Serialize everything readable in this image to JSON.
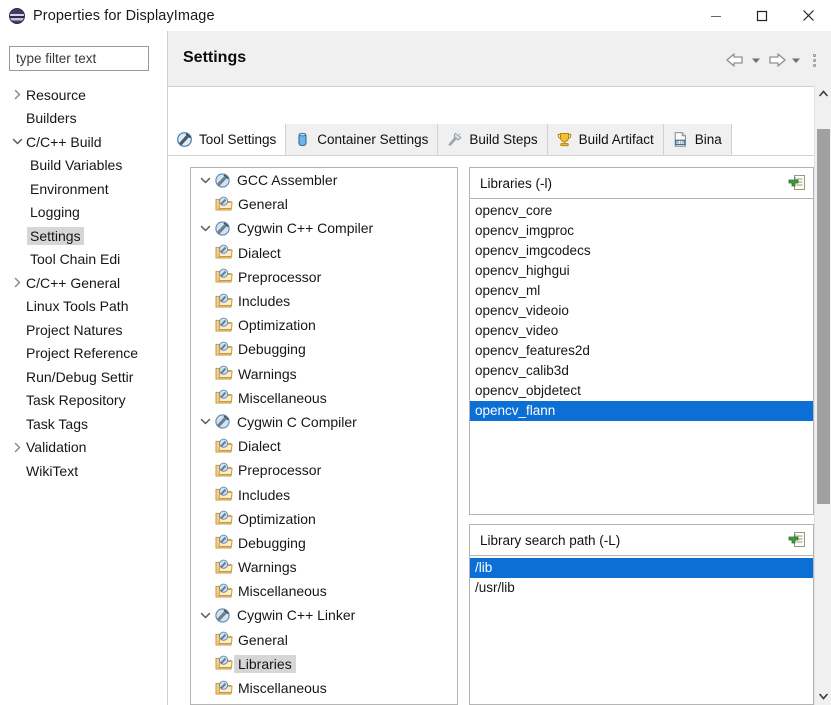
{
  "window": {
    "title": "Properties for DisplayImage",
    "icon": "eclipse-icon",
    "minimize_label": "—",
    "maximize_label": "□",
    "close_label": "✕"
  },
  "sidebar": {
    "filter": {
      "placeholder": "type filter text",
      "value": ""
    },
    "items": [
      {
        "label": "Resource",
        "indent": 0,
        "arrow": "collapsed",
        "selected": false
      },
      {
        "label": "Builders",
        "indent": 0,
        "arrow": "none",
        "selected": false
      },
      {
        "label": "C/C++ Build",
        "indent": 0,
        "arrow": "expanded",
        "selected": false
      },
      {
        "label": "Build Variables",
        "indent": 1,
        "arrow": "none",
        "selected": false
      },
      {
        "label": "Environment",
        "indent": 1,
        "arrow": "none",
        "selected": false
      },
      {
        "label": "Logging",
        "indent": 1,
        "arrow": "none",
        "selected": false
      },
      {
        "label": "Settings",
        "indent": 1,
        "arrow": "none",
        "selected": true
      },
      {
        "label": "Tool Chain Edi",
        "indent": 1,
        "arrow": "none",
        "selected": false
      },
      {
        "label": "C/C++ General",
        "indent": 0,
        "arrow": "collapsed",
        "selected": false
      },
      {
        "label": "Linux Tools Path",
        "indent": 0,
        "arrow": "none",
        "selected": false
      },
      {
        "label": "Project Natures",
        "indent": 0,
        "arrow": "none",
        "selected": false
      },
      {
        "label": "Project Reference",
        "indent": 0,
        "arrow": "none",
        "selected": false
      },
      {
        "label": "Run/Debug Settir",
        "indent": 0,
        "arrow": "none",
        "selected": false
      },
      {
        "label": "Task Repository",
        "indent": 0,
        "arrow": "none",
        "selected": false
      },
      {
        "label": "Task Tags",
        "indent": 0,
        "arrow": "none",
        "selected": false
      },
      {
        "label": "Validation",
        "indent": 0,
        "arrow": "collapsed",
        "selected": false
      },
      {
        "label": "WikiText",
        "indent": 0,
        "arrow": "none",
        "selected": false
      }
    ]
  },
  "header": {
    "title": "Settings",
    "back_icon": "back-arrow-icon",
    "back_dropdown_icon": "chevron-down-icon",
    "forward_icon": "forward-arrow-icon",
    "forward_dropdown_icon": "chevron-down-icon",
    "menu_icon": "kebab-menu-icon"
  },
  "tabs": [
    {
      "label": "Tool Settings",
      "icon": "tool-settings-icon",
      "active": true
    },
    {
      "label": "Container Settings",
      "icon": "container-icon",
      "active": false
    },
    {
      "label": "Build Steps",
      "icon": "build-steps-icon",
      "active": false
    },
    {
      "label": "Build Artifact",
      "icon": "trophy-icon",
      "active": false
    },
    {
      "label": "Bina",
      "icon": "binary-file-icon",
      "active": false
    }
  ],
  "tool_tree": [
    {
      "label": "GCC Assembler",
      "indent": 0,
      "arrow": "expanded",
      "icon": "tool-icon",
      "selected": false
    },
    {
      "label": "General",
      "indent": 1,
      "arrow": "none",
      "icon": "folder-tool-icon",
      "selected": false
    },
    {
      "label": "Cygwin C++ Compiler",
      "indent": 0,
      "arrow": "expanded",
      "icon": "tool-icon",
      "selected": false
    },
    {
      "label": "Dialect",
      "indent": 1,
      "arrow": "none",
      "icon": "folder-tool-icon",
      "selected": false
    },
    {
      "label": "Preprocessor",
      "indent": 1,
      "arrow": "none",
      "icon": "folder-tool-icon",
      "selected": false
    },
    {
      "label": "Includes",
      "indent": 1,
      "arrow": "none",
      "icon": "folder-tool-icon",
      "selected": false
    },
    {
      "label": "Optimization",
      "indent": 1,
      "arrow": "none",
      "icon": "folder-tool-icon",
      "selected": false
    },
    {
      "label": "Debugging",
      "indent": 1,
      "arrow": "none",
      "icon": "folder-tool-icon",
      "selected": false
    },
    {
      "label": "Warnings",
      "indent": 1,
      "arrow": "none",
      "icon": "folder-tool-icon",
      "selected": false
    },
    {
      "label": "Miscellaneous",
      "indent": 1,
      "arrow": "none",
      "icon": "folder-tool-icon",
      "selected": false
    },
    {
      "label": "Cygwin C Compiler",
      "indent": 0,
      "arrow": "expanded",
      "icon": "tool-icon",
      "selected": false
    },
    {
      "label": "Dialect",
      "indent": 1,
      "arrow": "none",
      "icon": "folder-tool-icon",
      "selected": false
    },
    {
      "label": "Preprocessor",
      "indent": 1,
      "arrow": "none",
      "icon": "folder-tool-icon",
      "selected": false
    },
    {
      "label": "Includes",
      "indent": 1,
      "arrow": "none",
      "icon": "folder-tool-icon",
      "selected": false
    },
    {
      "label": "Optimization",
      "indent": 1,
      "arrow": "none",
      "icon": "folder-tool-icon",
      "selected": false
    },
    {
      "label": "Debugging",
      "indent": 1,
      "arrow": "none",
      "icon": "folder-tool-icon",
      "selected": false
    },
    {
      "label": "Warnings",
      "indent": 1,
      "arrow": "none",
      "icon": "folder-tool-icon",
      "selected": false
    },
    {
      "label": "Miscellaneous",
      "indent": 1,
      "arrow": "none",
      "icon": "folder-tool-icon",
      "selected": false
    },
    {
      "label": "Cygwin C++ Linker",
      "indent": 0,
      "arrow": "expanded",
      "icon": "tool-icon",
      "selected": false
    },
    {
      "label": "General",
      "indent": 1,
      "arrow": "none",
      "icon": "folder-tool-icon",
      "selected": false
    },
    {
      "label": "Libraries",
      "indent": 1,
      "arrow": "none",
      "icon": "folder-tool-icon",
      "selected": true
    },
    {
      "label": "Miscellaneous",
      "indent": 1,
      "arrow": "none",
      "icon": "folder-tool-icon",
      "selected": false
    }
  ],
  "libraries_panel": {
    "title": "Libraries (-l)",
    "add_icon": "add-item-icon",
    "items": [
      {
        "label": "opencv_core",
        "selected": false
      },
      {
        "label": "opencv_imgproc",
        "selected": false
      },
      {
        "label": "opencv_imgcodecs",
        "selected": false
      },
      {
        "label": "opencv_highgui",
        "selected": false
      },
      {
        "label": "opencv_ml",
        "selected": false
      },
      {
        "label": "opencv_videoio",
        "selected": false
      },
      {
        "label": "opencv_video",
        "selected": false
      },
      {
        "label": "opencv_features2d",
        "selected": false
      },
      {
        "label": "opencv_calib3d",
        "selected": false
      },
      {
        "label": "opencv_objdetect",
        "selected": false
      },
      {
        "label": "opencv_flann",
        "selected": true
      }
    ]
  },
  "search_path_panel": {
    "title": "Library search path (-L)",
    "add_icon": "add-item-icon",
    "items": [
      {
        "label": "/lib",
        "selected": true
      },
      {
        "label": "/usr/lib",
        "selected": false
      }
    ]
  },
  "scrollbar": {
    "up_icon": "chevron-up-icon",
    "down_icon": "chevron-down-icon",
    "thumb": "scroll-thumb"
  },
  "colors": {
    "selection_blue": "#0b6fd6",
    "tree_selection_gray": "#d6d6d6",
    "header_gray": "#f0f0f0",
    "border_gray": "#b4b4b4"
  }
}
